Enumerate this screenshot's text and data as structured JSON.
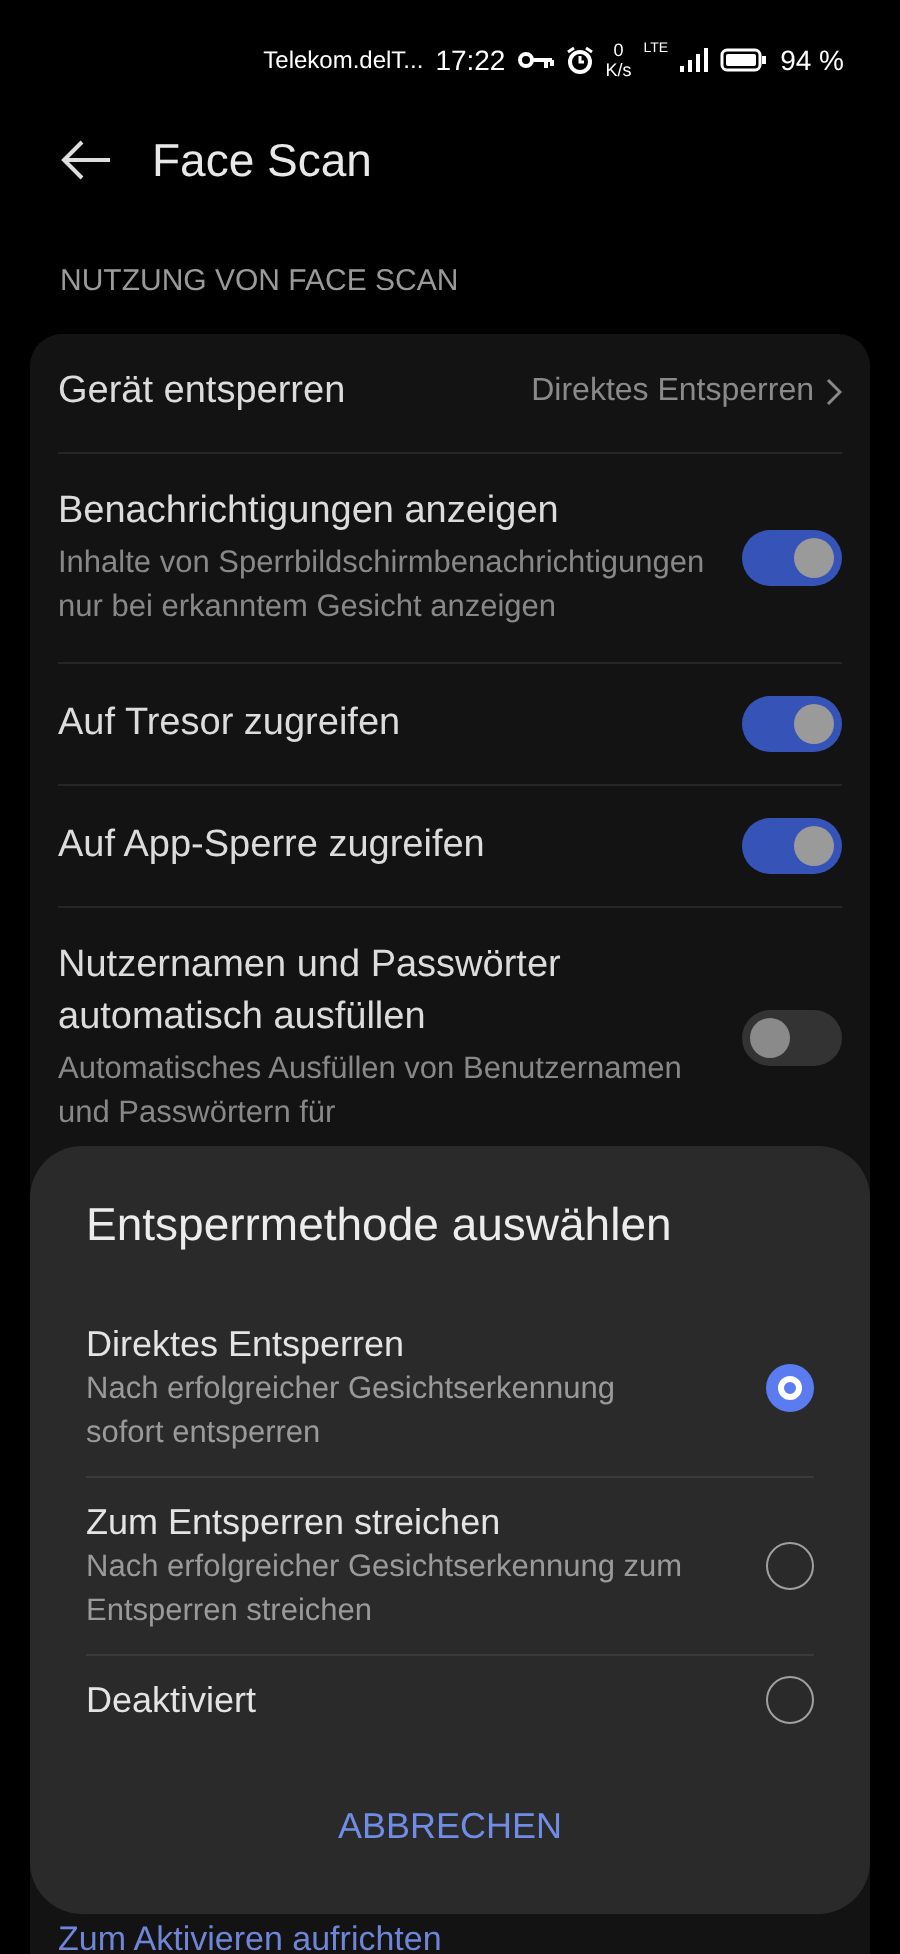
{
  "status_bar": {
    "carrier": "Telekom.delT...",
    "time": "17:22",
    "speed_value": "0",
    "speed_unit": "K/s",
    "network": "LTE",
    "battery": "94 %"
  },
  "header": {
    "title": "Face Scan"
  },
  "section": {
    "title": "NUTZUNG VON FACE SCAN"
  },
  "settings": [
    {
      "kind": "link",
      "title": "Gerät entsperren",
      "value": "Direktes Entsperren"
    },
    {
      "kind": "toggle",
      "title": "Benachrichtigungen anzeigen",
      "subtitle": "Inhalte von Sperrbildschirmbenachrichtigungen nur bei erkanntem Gesicht anzeigen",
      "on": true
    },
    {
      "kind": "toggle",
      "title": "Auf Tresor zugreifen",
      "on": true
    },
    {
      "kind": "toggle",
      "title": "Auf App-Sperre zugreifen",
      "on": true
    },
    {
      "kind": "toggle",
      "title": "Nutzernamen und Passwörter automatisch ausfüllen",
      "subtitle": "Automatisches Ausfüllen von Benutzernamen und Passwörtern für",
      "on": false
    }
  ],
  "partial_row": {
    "title": "Zum Aktivieren aufrichten"
  },
  "dialog": {
    "title": "Entsperrmethode auswählen",
    "options": [
      {
        "title": "Direktes Entsperren",
        "subtitle": "Nach erfolgreicher Gesichtserkennung sofort entsperren",
        "selected": true
      },
      {
        "title": "Zum Entsperren streichen",
        "subtitle": "Nach erfolgreicher Gesichtserkennung zum Entsperren streichen",
        "selected": false
      },
      {
        "title": "Deaktiviert",
        "selected": false
      }
    ],
    "cancel": "ABBRECHEN"
  }
}
